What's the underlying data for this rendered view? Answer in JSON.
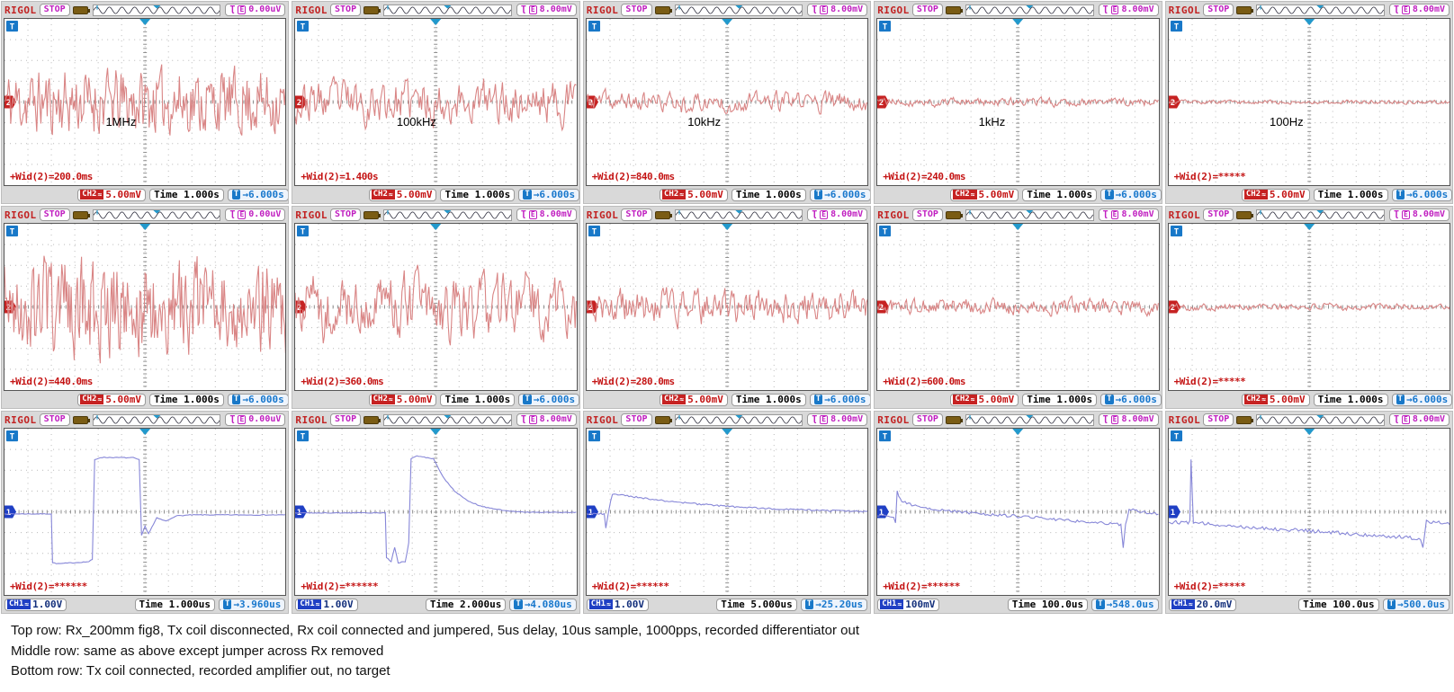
{
  "labels": {
    "brand": "RIGOL",
    "run_state": "STOP",
    "trigger_slope": "Ʈ",
    "trigger_edge": "E",
    "t_badge": "T",
    "coupling_glyph": "≈"
  },
  "colors": {
    "ch2_trace": "#d98585",
    "ch1_trace": "#8787d8",
    "trigger_marker": "#2299cc",
    "t_box": "#1878c8",
    "ch2_marker": "#c62222",
    "ch1_marker": "#1f3fc4",
    "grid_dot": "#b8b8b8",
    "grid_center": "#8f8f8f",
    "preview_wave": "#2a2a3a"
  },
  "caption": {
    "lines": [
      "Top row: Rx_200mm fig8, Tx coil disconnected, Rx coil connected and jumpered, 5us delay, 10us sample, 1000pps, recorded differentiator out",
      "Middle row: same as above except jumper across Rx removed",
      "Bottom row: Tx coil connected, recorded amplifier out, no target"
    ]
  },
  "panels": [
    {
      "trigger_value": "0.00uV",
      "measurement": "+Wid(2)=200.0ms",
      "freq_label": "1MHz",
      "channel": "CH2",
      "ch_scale": "5.00mV",
      "timebase": "Time 1.000s",
      "time_offset": "→6.000s",
      "marker": "2",
      "wave": {
        "kind": "noise",
        "seed": 11,
        "scale": 2.0,
        "alpha": 0.3,
        "n": 270
      }
    },
    {
      "trigger_value": "8.00mV",
      "measurement": "+Wid(2)=1.400s",
      "freq_label": "100kHz",
      "channel": "CH2",
      "ch_scale": "5.00mV",
      "timebase": "Time 1.000s",
      "time_offset": "→6.000s",
      "marker": "2",
      "wave": {
        "kind": "noise",
        "seed": 23,
        "scale": 1.7,
        "alpha": 0.5,
        "n": 240
      }
    },
    {
      "trigger_value": "8.00mV",
      "measurement": "+Wid(2)=840.0ms",
      "freq_label": "10kHz",
      "channel": "CH2",
      "ch_scale": "5.00mV",
      "timebase": "Time 1.000s",
      "time_offset": "→6.000s",
      "marker": "2",
      "wave": {
        "kind": "noise",
        "seed": 37,
        "scale": 0.85,
        "alpha": 0.55,
        "n": 240
      }
    },
    {
      "trigger_value": "8.00mV",
      "measurement": "+Wid(2)=240.0ms",
      "freq_label": "1kHz",
      "channel": "CH2",
      "ch_scale": "5.00mV",
      "timebase": "Time 1.000s",
      "time_offset": "→6.000s",
      "marker": "2",
      "wave": {
        "kind": "noise",
        "seed": 41,
        "scale": 0.33,
        "alpha": 0.5,
        "n": 240
      }
    },
    {
      "trigger_value": "8.00mV",
      "measurement": "+Wid(2)=*****",
      "freq_label": "100Hz",
      "channel": "CH2",
      "ch_scale": "5.00mV",
      "timebase": "Time 1.000s",
      "time_offset": "→6.000s",
      "marker": "2",
      "wave": {
        "kind": "noise",
        "seed": 53,
        "scale": 0.14,
        "alpha": 0.45,
        "n": 240
      }
    },
    {
      "trigger_value": "0.00uV",
      "measurement": "+Wid(2)=440.0ms",
      "channel": "CH2",
      "ch_scale": "5.00mV",
      "timebase": "Time 1.000s",
      "time_offset": "→6.000s",
      "marker": "2",
      "wave": {
        "kind": "noise",
        "seed": 67,
        "scale": 3.1,
        "alpha": 0.35,
        "n": 270
      }
    },
    {
      "trigger_value": "8.00mV",
      "measurement": "+Wid(2)=360.0ms",
      "channel": "CH2",
      "ch_scale": "5.00mV",
      "timebase": "Time 1.000s",
      "time_offset": "→6.000s",
      "marker": "2",
      "wave": {
        "kind": "noise",
        "seed": 71,
        "scale": 2.6,
        "alpha": 0.5,
        "n": 250
      }
    },
    {
      "trigger_value": "8.00mV",
      "measurement": "+Wid(2)=280.0ms",
      "channel": "CH2",
      "ch_scale": "5.00mV",
      "timebase": "Time 1.000s",
      "time_offset": "→6.000s",
      "marker": "2",
      "wave": {
        "kind": "noise",
        "seed": 83,
        "scale": 1.5,
        "alpha": 0.55,
        "n": 250
      }
    },
    {
      "trigger_value": "8.00mV",
      "measurement": "+Wid(2)=600.0ms",
      "channel": "CH2",
      "ch_scale": "5.00mV",
      "timebase": "Time 1.000s",
      "time_offset": "→6.000s",
      "marker": "2",
      "wave": {
        "kind": "noise",
        "seed": 97,
        "scale": 0.62,
        "alpha": 0.5,
        "n": 250
      }
    },
    {
      "trigger_value": "8.00mV",
      "measurement": "+Wid(2)=*****",
      "channel": "CH2",
      "ch_scale": "5.00mV",
      "timebase": "Time 1.000s",
      "time_offset": "→6.000s",
      "marker": "2",
      "wave": {
        "kind": "noise",
        "seed": 101,
        "scale": 0.27,
        "alpha": 0.5,
        "n": 250
      }
    },
    {
      "trigger_value": "0.00uV",
      "measurement": "+Wid(2)=******",
      "channel": "CH1",
      "ch_scale": "1.00V",
      "timebase": "Time 1.000us",
      "time_offset": "→3.960us",
      "marker": "1",
      "wave": {
        "kind": "path",
        "seed": 7,
        "jitter": 0.02,
        "points": [
          [
            0,
            -0.1
          ],
          [
            2.0,
            -0.1
          ],
          [
            2.05,
            -2.45
          ],
          [
            2.3,
            -2.5
          ],
          [
            3.6,
            -2.4
          ],
          [
            3.75,
            -2.3
          ],
          [
            3.85,
            2.5
          ],
          [
            4.1,
            2.62
          ],
          [
            5.5,
            2.6
          ],
          [
            5.75,
            2.5
          ],
          [
            5.85,
            -1.15
          ],
          [
            6.0,
            -0.7
          ],
          [
            6.15,
            -1.05
          ],
          [
            6.5,
            -0.3
          ],
          [
            6.9,
            -0.45
          ],
          [
            7.3,
            -0.2
          ],
          [
            8.0,
            -0.15
          ],
          [
            12,
            -0.15
          ]
        ]
      }
    },
    {
      "trigger_value": "8.00mV",
      "measurement": "+Wid(2)=******",
      "channel": "CH1",
      "ch_scale": "1.00V",
      "timebase": "Time 2.000us",
      "time_offset": "→4.080us",
      "marker": "1",
      "wave": {
        "kind": "path",
        "seed": 8,
        "jitter": 0.02,
        "points": [
          [
            0,
            -0.05
          ],
          [
            3.85,
            -0.05
          ],
          [
            3.9,
            -2.2
          ],
          [
            4.1,
            -2.4
          ],
          [
            4.25,
            -1.7
          ],
          [
            4.4,
            -2.45
          ],
          [
            4.7,
            -2.4
          ],
          [
            4.85,
            -1.5
          ],
          [
            4.95,
            2.55
          ],
          [
            5.2,
            2.7
          ],
          [
            5.9,
            2.55
          ],
          [
            6.3,
            1.7
          ],
          [
            6.8,
            1.0
          ],
          [
            7.4,
            0.5
          ],
          [
            8.0,
            0.25
          ],
          [
            9.0,
            0.05
          ],
          [
            10,
            -0.02
          ],
          [
            12,
            -0.03
          ]
        ]
      }
    },
    {
      "trigger_value": "8.00mV",
      "measurement": "+Wid(2)=******",
      "channel": "CH1",
      "ch_scale": "1.00V",
      "timebase": "Time 5.000us",
      "time_offset": "→25.20us",
      "marker": "1",
      "wave": {
        "kind": "path",
        "seed": 9,
        "jitter": 0.04,
        "points": [
          [
            0,
            -0.1
          ],
          [
            0.75,
            -0.1
          ],
          [
            0.82,
            -0.8
          ],
          [
            0.95,
            0.1
          ],
          [
            1.1,
            0.85
          ],
          [
            1.5,
            0.8
          ],
          [
            2.5,
            0.65
          ],
          [
            3.5,
            0.5
          ],
          [
            4.5,
            0.4
          ],
          [
            5.5,
            0.3
          ],
          [
            7.0,
            0.2
          ],
          [
            9.0,
            0.1
          ],
          [
            10.5,
            0.05
          ],
          [
            12,
            0.02
          ]
        ]
      }
    },
    {
      "trigger_value": "8.00mV",
      "measurement": "+Wid(2)=******",
      "channel": "CH1",
      "ch_scale": "100mV",
      "timebase": "Time 100.0us",
      "time_offset": "→548.0us",
      "marker": "1",
      "wave": {
        "kind": "path",
        "seed": 10,
        "jitter": 0.07,
        "points": [
          [
            0,
            -0.2
          ],
          [
            0.7,
            -0.2
          ],
          [
            0.78,
            -0.6
          ],
          [
            0.85,
            0.95
          ],
          [
            1.05,
            0.5
          ],
          [
            1.4,
            0.35
          ],
          [
            2,
            0.22
          ],
          [
            3,
            0.05
          ],
          [
            4,
            -0.05
          ],
          [
            5,
            -0.15
          ],
          [
            6,
            -0.22
          ],
          [
            7,
            -0.3
          ],
          [
            8,
            -0.4
          ],
          [
            9,
            -0.5
          ],
          [
            9.8,
            -0.55
          ],
          [
            10.4,
            -0.6
          ],
          [
            10.5,
            -1.7
          ],
          [
            10.6,
            -0.6
          ],
          [
            10.75,
            0.15
          ],
          [
            11.0,
            0.05
          ],
          [
            11.5,
            -0.05
          ],
          [
            12,
            -0.1
          ]
        ]
      }
    },
    {
      "trigger_value": "8.00mV",
      "measurement": "+Wid(2)=*****",
      "channel": "CH1",
      "ch_scale": "20.0mV",
      "timebase": "Time 100.0us",
      "time_offset": "→500.0us",
      "marker": "1",
      "wave": {
        "kind": "path",
        "seed": 12,
        "jitter": 0.09,
        "points": [
          [
            0,
            -0.5
          ],
          [
            0.9,
            -0.5
          ],
          [
            0.95,
            2.55
          ],
          [
            1.05,
            -0.55
          ],
          [
            2,
            -0.6
          ],
          [
            3,
            -0.7
          ],
          [
            4,
            -0.78
          ],
          [
            5,
            -0.85
          ],
          [
            6,
            -0.92
          ],
          [
            7,
            -1.0
          ],
          [
            8,
            -1.08
          ],
          [
            9,
            -1.15
          ],
          [
            10,
            -1.22
          ],
          [
            10.75,
            -1.28
          ],
          [
            10.85,
            -1.75
          ],
          [
            11.0,
            -0.45
          ],
          [
            11.6,
            -0.5
          ],
          [
            12,
            -0.55
          ]
        ]
      }
    }
  ]
}
